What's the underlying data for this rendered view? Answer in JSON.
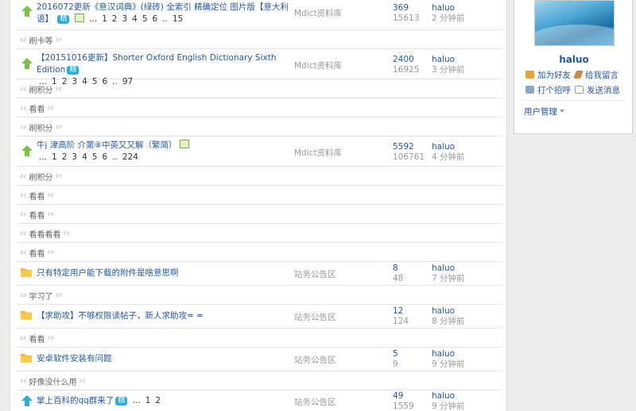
{
  "threads": {
    "t1": {
      "title_line1": "2016072更新《意汉词典》(绿砖) 全索引 精确定位 图片版【意大利",
      "title_line2": "语】",
      "badge": "精",
      "pages": [
        "...",
        "1",
        "2",
        "3",
        "4",
        "5",
        "6",
        "..",
        "15"
      ],
      "forum": "Mdict资料库",
      "replies": "369",
      "views": "15613",
      "last_user": "haluo",
      "last_time": "2 分钟前"
    },
    "t2": {
      "title": "【20151016更新】Shorter Oxford English Dictionary Sixth Edition",
      "badge": "精",
      "pages": [
        "...",
        "1",
        "2",
        "3",
        "4",
        "5",
        "6",
        "..",
        "97"
      ],
      "forum": "Mdict资料库",
      "replies": "2400",
      "views": "16925",
      "last_user": "haluo",
      "last_time": "3 分钟前"
    },
    "t3": {
      "title": "牛j 津高阶 介第⑧中英又又解（繁简）",
      "pages": [
        "...",
        "1",
        "2",
        "3",
        "4",
        "5",
        "6",
        "..",
        "224"
      ],
      "forum": "Mdict资料库",
      "replies": "5592",
      "views": "106761",
      "last_user": "haluo",
      "last_time": "4 分钟前"
    },
    "t4": {
      "title": "只有特定用户能下载的附件是啥意思啊",
      "forum": "站务公告区",
      "replies": "8",
      "views": "48",
      "last_user": "haluo",
      "last_time": "7 分钟前"
    },
    "t5": {
      "title": "【求助攻】不够权限读帖子，新人求助攻= =",
      "forum": "站务公告区",
      "replies": "12",
      "views": "124",
      "last_user": "haluo",
      "last_time": "8 分钟前"
    },
    "t6": {
      "title": "安卓软件安装有问题",
      "forum": "站务公告区",
      "replies": "5",
      "views": "9",
      "last_user": "haluo",
      "last_time": "9 分钟前"
    },
    "t7": {
      "title": "掌上百科的qq群来了",
      "badge": "精",
      "pages": [
        "...",
        "1",
        "2"
      ],
      "forum": "站务公告区",
      "replies": "49",
      "views": "1559",
      "last_user": "haluo",
      "last_time": "9 分钟前"
    }
  },
  "quotes": {
    "q1": "刷卡等",
    "q2": "刷积分",
    "q3": "看看",
    "q4": "刷积分",
    "q5": "刷积分",
    "q6": "看看",
    "q7": "看看",
    "q8": "看看看看",
    "q9": "看看",
    "q10": "学习了",
    "q11": "看看",
    "q12": "好像没什么用"
  },
  "sidebar": {
    "username": "haluo",
    "add_friend": "加为好友",
    "leave_message": "给我留言",
    "greet": "打个招呼",
    "send_message": "发送消息",
    "user_management": "用户管理"
  },
  "colors": {
    "link": "#2457a8",
    "badge": "#27b0d6",
    "hot_icon": "#7cc242",
    "folder_icon": "#f5b637",
    "dim": "#999999"
  }
}
